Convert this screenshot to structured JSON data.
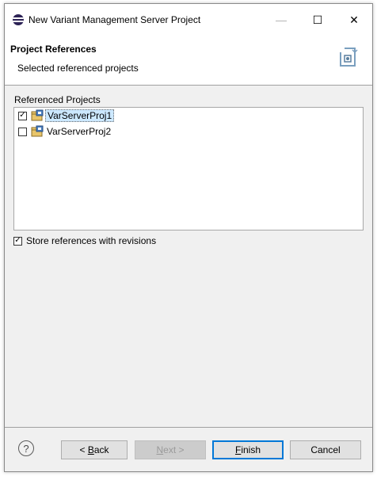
{
  "window": {
    "title": "New Variant Management Server Project",
    "minimize_glyph": "—",
    "maximize_glyph": "☐",
    "close_glyph": "✕"
  },
  "header": {
    "title": "Project References",
    "description": "Selected referenced projects",
    "icon": "wizard-banner-icon"
  },
  "section_label": "Referenced Projects",
  "projects": [
    {
      "label": "VarServerProj1",
      "checked": true,
      "selected": true,
      "icon": "project-icon"
    },
    {
      "label": "VarServerProj2",
      "checked": false,
      "selected": false,
      "icon": "project-icon"
    }
  ],
  "store_option": {
    "label": "Store references with revisions",
    "checked": true
  },
  "footer": {
    "help_glyph": "?",
    "back_prefix": "< ",
    "back_mnemonic": "B",
    "back_rest": "ack",
    "next_mnemonic": "N",
    "next_rest": "ext >",
    "finish_mnemonic": "F",
    "finish_rest": "inish",
    "cancel_label": "Cancel"
  },
  "colors": {
    "dialog_bg": "#f0f0f0",
    "selection_bg": "#cce8ff",
    "default_button_border": "#0078d7"
  }
}
